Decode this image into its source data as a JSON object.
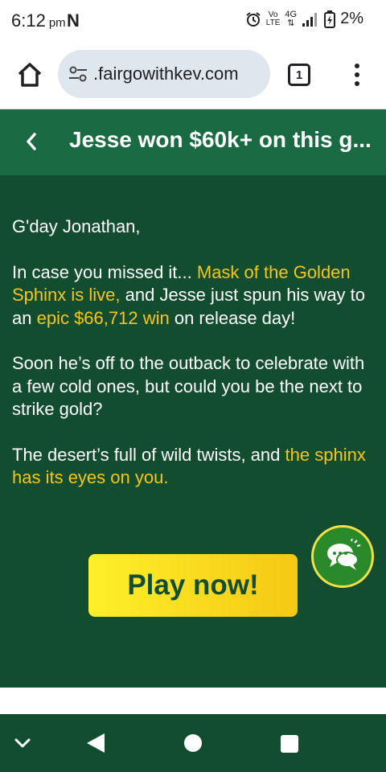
{
  "status_bar": {
    "time": "6:12",
    "ampm": "pm",
    "notification_letter": "N",
    "network_vo": "Vo",
    "network_lte": "LTE",
    "network_type": "4G",
    "battery": "2%"
  },
  "browser": {
    "url": ".fairgowithkev.com",
    "tab_count": "1"
  },
  "email": {
    "title": "Jesse won $60k+ on this g...",
    "greeting": "G'day Jonathan,",
    "p1_a": "In case you missed it... ",
    "p1_b": "Mask of the Golden Sphinx is live,",
    "p1_c": " and Jesse just spun his way to an ",
    "p1_d": "epic $66,712 win",
    "p1_e": " on release day!",
    "p2": "Soon he’s off to the outback to celebrate with a few cold ones, but could you be the next to strike gold?",
    "p3_a": "The desert’s full of wild twists, and ",
    "p3_b": "the sphinx has its eyes on you.",
    "cta_label": "Play now!"
  },
  "colors": {
    "header_bg": "#1a6b43",
    "body_bg": "#134d30",
    "highlight": "#f5c518",
    "cta_gradient_start": "#fdf02a",
    "cta_gradient_end": "#f5c814"
  },
  "icons": {
    "alarm": "alarm-icon",
    "signal": "signal-icon",
    "battery": "battery-charging-icon",
    "home": "home-icon",
    "site_settings": "tune-icon",
    "menu": "more-vert-icon",
    "back": "chevron-left-icon",
    "chat": "chat-bubbles-icon",
    "nav_collapse": "chevron-down-icon",
    "nav_back": "triangle-back-icon",
    "nav_home": "circle-home-icon",
    "nav_recents": "square-recents-icon"
  }
}
